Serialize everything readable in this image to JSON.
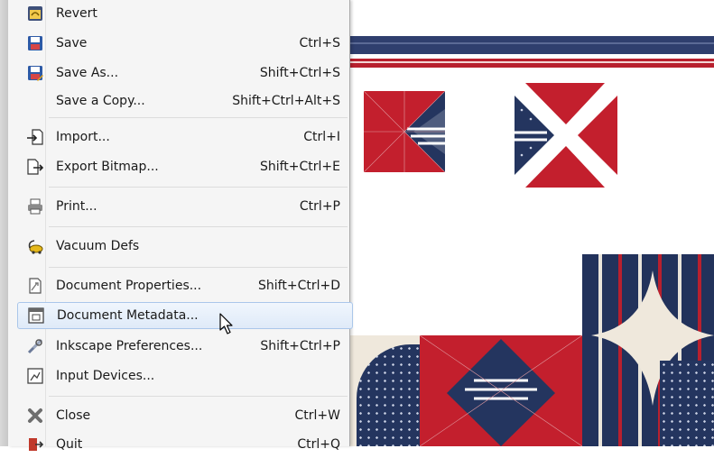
{
  "menu": {
    "items": [
      {
        "label": "Revert",
        "accel": "",
        "icon": "revert-icon"
      },
      {
        "label": "Save",
        "accel": "Ctrl+S",
        "icon": "save-icon"
      },
      {
        "label": "Save As...",
        "accel": "Shift+Ctrl+S",
        "icon": "save-as-icon"
      },
      {
        "label": "Save a Copy...",
        "accel": "Shift+Ctrl+Alt+S",
        "icon": ""
      },
      {
        "label": "Import...",
        "accel": "Ctrl+I",
        "icon": "import-icon"
      },
      {
        "label": "Export Bitmap...",
        "accel": "Shift+Ctrl+E",
        "icon": "export-icon"
      },
      {
        "label": "Print...",
        "accel": "Ctrl+P",
        "icon": "printer-icon"
      },
      {
        "label": "Vacuum Defs",
        "accel": "",
        "icon": "vacuum-icon"
      },
      {
        "label": "Document Properties...",
        "accel": "Shift+Ctrl+D",
        "icon": "document-properties-icon"
      },
      {
        "label": "Document Metadata...",
        "accel": "",
        "icon": "document-metadata-icon"
      },
      {
        "label": "Inkscape Preferences...",
        "accel": "Shift+Ctrl+P",
        "icon": "preferences-icon"
      },
      {
        "label": "Input Devices...",
        "accel": "",
        "icon": "input-devices-icon"
      },
      {
        "label": "Close",
        "accel": "Ctrl+W",
        "icon": "close-icon"
      },
      {
        "label": "Quit",
        "accel": "Ctrl+Q",
        "icon": "quit-icon"
      }
    ],
    "highlighted_item": "Document Metadata..."
  },
  "colors": {
    "menu_bg": "#f5f5f5",
    "highlight_bg": "#dfeaf8",
    "highlight_border": "#aac7ea",
    "fabric_red": "#c31f2d",
    "fabric_navy": "#24355f",
    "fabric_cream": "#efe8dc"
  }
}
